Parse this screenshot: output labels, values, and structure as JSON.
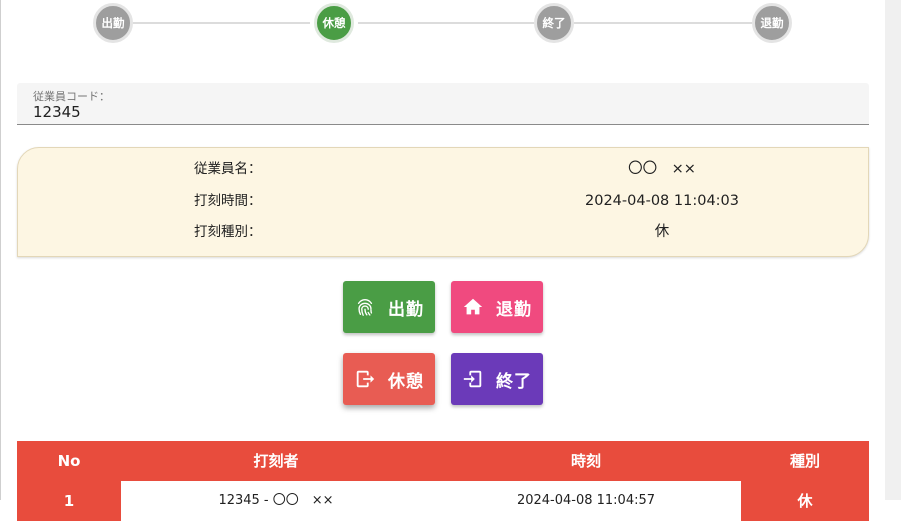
{
  "stepper": {
    "steps": [
      {
        "label": "出勤",
        "state": "inactive"
      },
      {
        "label": "休憩",
        "state": "active"
      },
      {
        "label": "終了",
        "state": "inactive"
      },
      {
        "label": "退勤",
        "state": "inactive"
      }
    ]
  },
  "employee_code": {
    "label": "従業員コード：",
    "value": "12345"
  },
  "info": {
    "rows": [
      {
        "label": "従業員名：",
        "value": "〇〇　××"
      },
      {
        "label": "打刻時間：",
        "value": "2024-04-08 11:04:03"
      },
      {
        "label": "打刻種別：",
        "value": "休"
      }
    ]
  },
  "actions": {
    "clock_in": "出勤",
    "clock_out": "退勤",
    "break_start": "休憩",
    "break_end": "終了"
  },
  "table": {
    "headers": {
      "no": "No",
      "user": "打刻者",
      "time": "時刻",
      "type": "種別"
    },
    "rows": [
      {
        "no": "1",
        "user": "12345 - 〇〇　××",
        "time": "2024-04-08 11:04:57",
        "type": "休"
      }
    ]
  },
  "colors": {
    "green": "#4a9d45",
    "pink": "#f04a7f",
    "red": "#e85c53",
    "purple": "#6b3ab9",
    "table_header": "#e84c3d",
    "info_bg": "#fdf6e3"
  }
}
